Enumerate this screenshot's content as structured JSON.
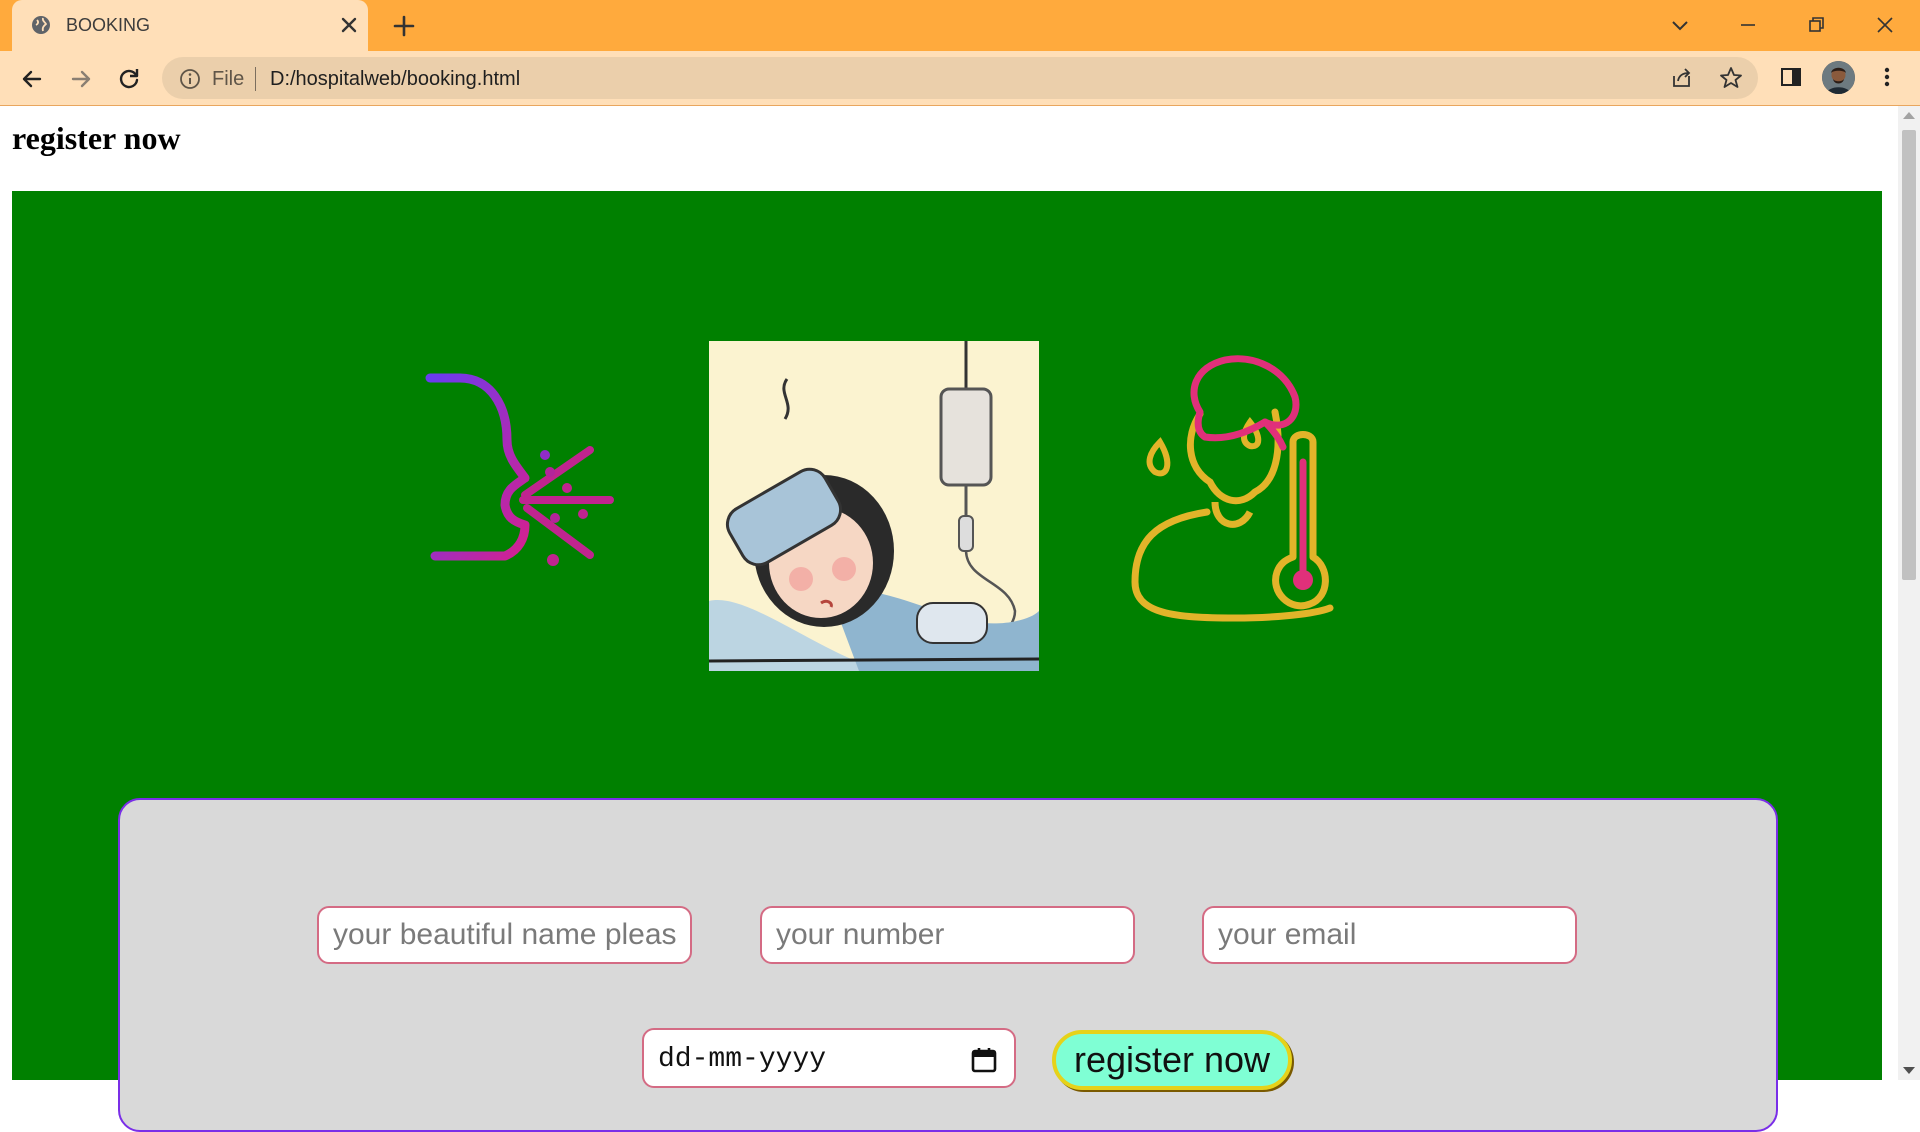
{
  "browser": {
    "tab_title": "BOOKING",
    "address_scheme": "File",
    "address_url": "D:/hospitalweb/booking.html",
    "tab_color": "#ffaa3d",
    "toolbar_color": "#ffdfb8"
  },
  "page": {
    "title": "register now",
    "background_color": "#008000",
    "images": [
      {
        "name": "cough-icon",
        "description_icon": "person-coughing-icon"
      },
      {
        "name": "sick-patient-illustration",
        "description_icon": "sick-patient-iv-drip"
      },
      {
        "name": "fever-icon",
        "description_icon": "person-fever-thermometer-icon"
      }
    ]
  },
  "form": {
    "name_placeholder": "your beautiful name please",
    "number_placeholder": "your number",
    "email_placeholder": "your email",
    "date_placeholder": "dd-mm-yyyy",
    "submit_label": "register now",
    "panel_color": "#d9d9d9",
    "panel_border_color": "#7a2ee8",
    "submit_color": "#7fffd4",
    "submit_border_color": "#e6d21a"
  }
}
